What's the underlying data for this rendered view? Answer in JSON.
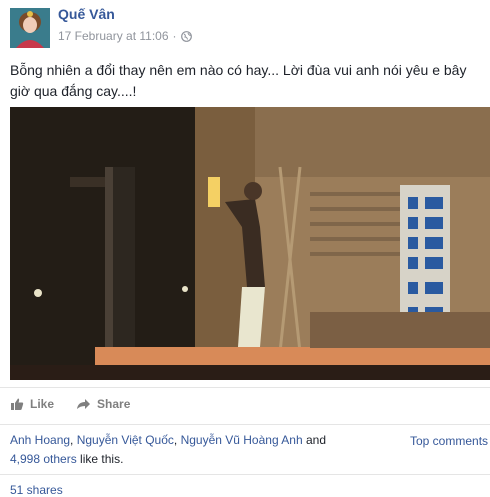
{
  "author": {
    "name": "Quế Vân"
  },
  "post": {
    "timestamp": "17 February at 11:06",
    "separator": "·",
    "text": "Bỗng nhiên a đổi thay nên em nào có hay... Lời đùa vui anh nói yêu e bây giờ qua đắng cay....!"
  },
  "actions": {
    "like": "Like",
    "share": "Share"
  },
  "reactions": {
    "names": [
      "Anh Hoang",
      "Nguyễn Việt Quốc",
      "Nguyễn Vũ Hoàng Anh"
    ],
    "sep1": ", ",
    "sep2": ", ",
    "and": " and",
    "others": "4,998 others",
    "suffix": " like this."
  },
  "comments": {
    "sort_label": "Top comments"
  },
  "shares": {
    "label": "51 shares"
  },
  "colors": {
    "link": "#365899",
    "meta": "#90949c",
    "action": "#7f7f7f"
  }
}
